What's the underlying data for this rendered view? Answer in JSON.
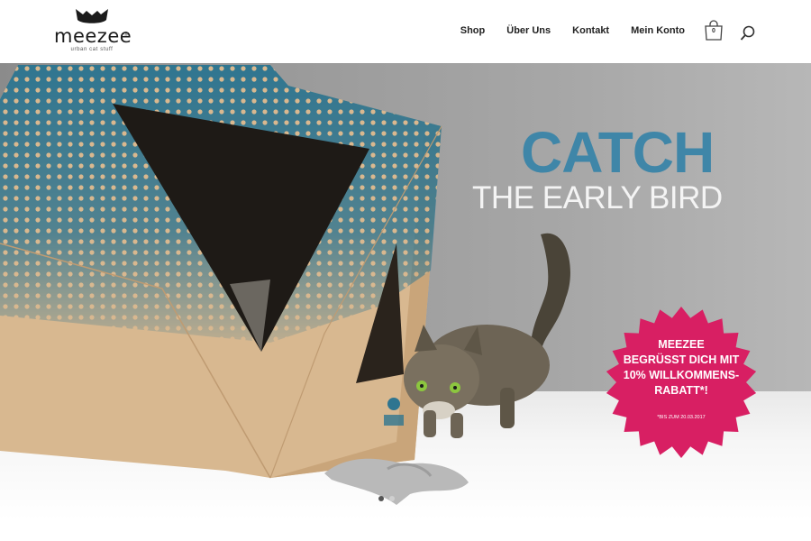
{
  "brand": {
    "name": "meezee",
    "registered": "®",
    "tagline": "urban cat stuff"
  },
  "nav": {
    "items": [
      "Shop",
      "Über Uns",
      "Kontakt",
      "Mein Konto"
    ]
  },
  "cart": {
    "count": "0"
  },
  "hero": {
    "headline_primary": "CATCH",
    "headline_secondary": "THE EARLY BIRD",
    "badge": {
      "lines": [
        "MEEZEE",
        "BEGRÜSST DICH MIT",
        "10% WILLKOMMENS-",
        "RABATT*!"
      ],
      "note": "*BIS ZUM 20.03.2017"
    },
    "slide_active": 1
  },
  "colors": {
    "accent_blue": "#3f86a8",
    "badge_pink": "#d81f63",
    "cardboard": "#d8b890"
  },
  "icons": [
    "cat-logo-icon",
    "shopping-bag-icon",
    "search-icon"
  ]
}
